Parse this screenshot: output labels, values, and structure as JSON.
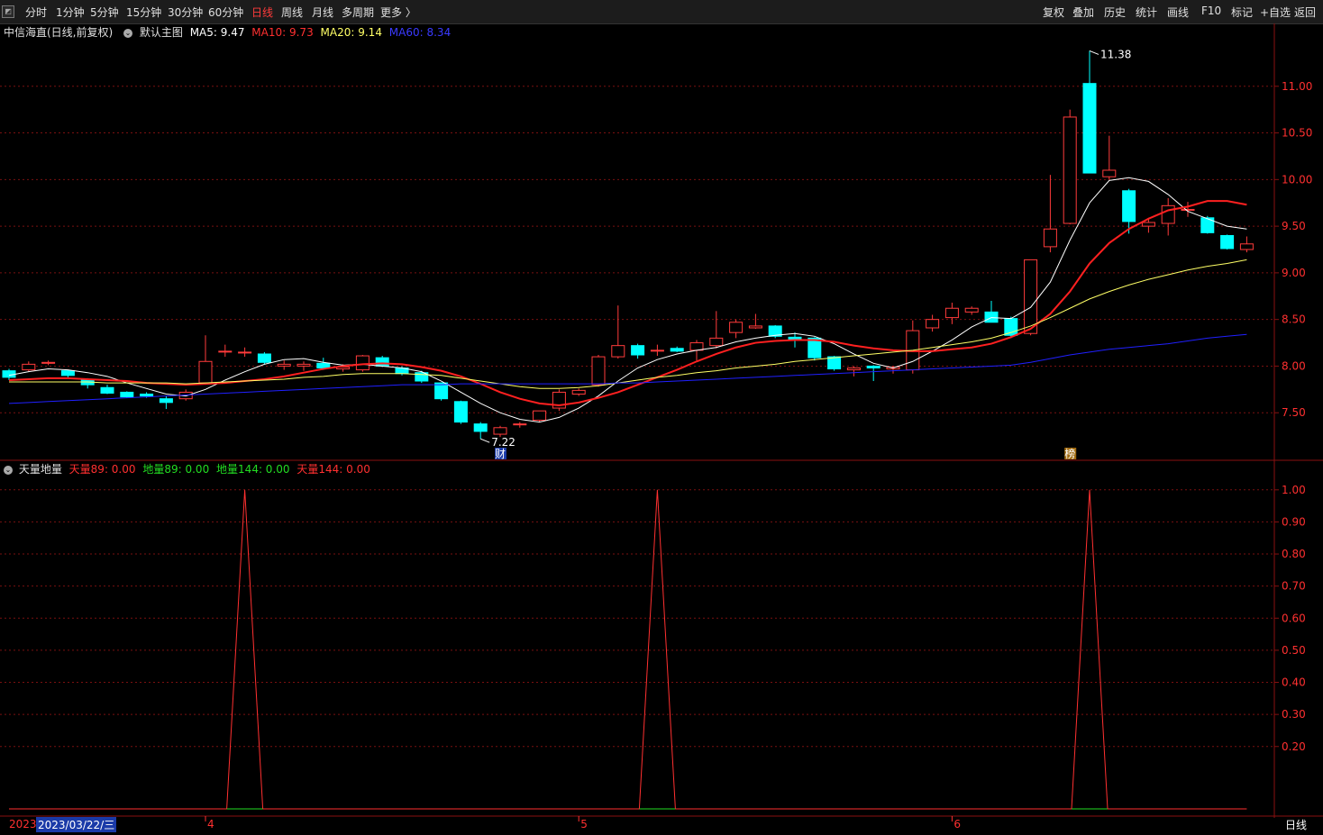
{
  "toolbar": {
    "periods": [
      "分时",
      "1分钟",
      "5分钟",
      "15分钟",
      "30分钟",
      "60分钟",
      "日线",
      "周线",
      "月线",
      "多周期",
      "更多 〉"
    ],
    "active_period": "日线",
    "right_buttons": [
      "复权",
      "叠加",
      "历史",
      "统计",
      "画线",
      "F10",
      "标记",
      "+自选",
      "返回"
    ]
  },
  "main_info": {
    "stock": "中信海直(日线,前复权)",
    "template": "默认主图",
    "ma5": "MA5: 9.47",
    "ma10": "MA10: 9.73",
    "ma20": "MA20: 9.14",
    "ma60": "MA60: 8.34"
  },
  "sub_info": {
    "name": "天量地量",
    "tian89": "天量89: 0.00",
    "di89": "地量89: 0.00",
    "di144": "地量144: 0.00",
    "tian144": "天量144: 0.00"
  },
  "annotations": {
    "high": "11.38",
    "low": "7.22",
    "marker_cai": "财",
    "marker_bang": "榜"
  },
  "x_axis": {
    "labels": [
      "2023",
      "4",
      "5",
      "6"
    ],
    "cursor_date": "2023/03/22/三",
    "period_label": "日线"
  },
  "colors": {
    "up": "#ff3b3b",
    "down": "#00ffff",
    "ma5": "#ffffff",
    "ma10": "#ff2020",
    "ma20": "#ffff66",
    "ma60": "#2020ff",
    "grid": "#7a1010"
  },
  "chart_data": [
    {
      "type": "candlestick",
      "title": "中信海直(日线,前复权)",
      "ylim": [
        7.0,
        11.5
      ],
      "yticks": [
        7.5,
        8.0,
        8.5,
        9.0,
        9.5,
        10.0,
        10.5,
        11.0
      ],
      "candles": [
        {
          "o": 7.95,
          "h": 7.97,
          "l": 7.85,
          "c": 7.88
        },
        {
          "o": 7.96,
          "h": 8.05,
          "l": 7.94,
          "c": 8.02
        },
        {
          "o": 8.03,
          "h": 8.06,
          "l": 8.01,
          "c": 8.04
        },
        {
          "o": 7.95,
          "h": 7.96,
          "l": 7.88,
          "c": 7.9
        },
        {
          "o": 7.85,
          "h": 7.87,
          "l": 7.76,
          "c": 7.8
        },
        {
          "o": 7.77,
          "h": 7.8,
          "l": 7.7,
          "c": 7.71
        },
        {
          "o": 7.72,
          "h": 7.73,
          "l": 7.66,
          "c": 7.67
        },
        {
          "o": 7.7,
          "h": 7.72,
          "l": 7.66,
          "c": 7.68
        },
        {
          "o": 7.65,
          "h": 7.68,
          "l": 7.54,
          "c": 7.61
        },
        {
          "o": 7.65,
          "h": 7.75,
          "l": 7.63,
          "c": 7.72
        },
        {
          "o": 7.82,
          "h": 8.33,
          "l": 7.8,
          "c": 8.05
        },
        {
          "o": 8.16,
          "h": 8.23,
          "l": 8.1,
          "c": 8.16
        },
        {
          "o": 8.15,
          "h": 8.2,
          "l": 8.1,
          "c": 8.15
        },
        {
          "o": 8.13,
          "h": 8.15,
          "l": 8.02,
          "c": 8.04
        },
        {
          "o": 8.0,
          "h": 8.06,
          "l": 7.96,
          "c": 8.02
        },
        {
          "o": 8.0,
          "h": 8.05,
          "l": 7.95,
          "c": 8.02
        },
        {
          "o": 8.03,
          "h": 8.09,
          "l": 7.96,
          "c": 7.98
        },
        {
          "o": 7.97,
          "h": 8.02,
          "l": 7.94,
          "c": 7.99
        },
        {
          "o": 7.96,
          "h": 8.12,
          "l": 7.94,
          "c": 8.11
        },
        {
          "o": 8.09,
          "h": 8.11,
          "l": 7.99,
          "c": 8.0
        },
        {
          "o": 7.98,
          "h": 8.0,
          "l": 7.9,
          "c": 7.92
        },
        {
          "o": 7.93,
          "h": 7.95,
          "l": 7.82,
          "c": 7.84
        },
        {
          "o": 7.82,
          "h": 7.82,
          "l": 7.63,
          "c": 7.65
        },
        {
          "o": 7.62,
          "h": 7.63,
          "l": 7.38,
          "c": 7.4
        },
        {
          "o": 7.38,
          "h": 7.4,
          "l": 7.22,
          "c": 7.3
        },
        {
          "o": 7.27,
          "h": 7.36,
          "l": 7.24,
          "c": 7.34
        },
        {
          "o": 7.37,
          "h": 7.4,
          "l": 7.34,
          "c": 7.38
        },
        {
          "o": 7.42,
          "h": 7.52,
          "l": 7.4,
          "c": 7.52
        },
        {
          "o": 7.55,
          "h": 7.75,
          "l": 7.52,
          "c": 7.72
        },
        {
          "o": 7.7,
          "h": 7.76,
          "l": 7.68,
          "c": 7.74
        },
        {
          "o": 7.8,
          "h": 8.12,
          "l": 7.78,
          "c": 8.1
        },
        {
          "o": 8.1,
          "h": 8.65,
          "l": 8.08,
          "c": 8.22
        },
        {
          "o": 8.22,
          "h": 8.24,
          "l": 8.08,
          "c": 8.12
        },
        {
          "o": 8.17,
          "h": 8.23,
          "l": 8.11,
          "c": 8.17
        },
        {
          "o": 8.19,
          "h": 8.21,
          "l": 8.15,
          "c": 8.16
        },
        {
          "o": 8.17,
          "h": 8.28,
          "l": 8.06,
          "c": 8.25
        },
        {
          "o": 8.22,
          "h": 8.59,
          "l": 8.19,
          "c": 8.3
        },
        {
          "o": 8.36,
          "h": 8.5,
          "l": 8.3,
          "c": 8.47
        },
        {
          "o": 8.41,
          "h": 8.56,
          "l": 8.4,
          "c": 8.43
        },
        {
          "o": 8.43,
          "h": 8.44,
          "l": 8.3,
          "c": 8.32
        },
        {
          "o": 8.31,
          "h": 8.36,
          "l": 8.2,
          "c": 8.28
        },
        {
          "o": 8.3,
          "h": 8.31,
          "l": 8.06,
          "c": 8.09
        },
        {
          "o": 8.1,
          "h": 8.11,
          "l": 7.95,
          "c": 7.97
        },
        {
          "o": 7.96,
          "h": 8.0,
          "l": 7.89,
          "c": 7.98
        },
        {
          "o": 8.0,
          "h": 8.01,
          "l": 7.84,
          "c": 7.98
        },
        {
          "o": 7.97,
          "h": 8.0,
          "l": 7.92,
          "c": 7.99
        },
        {
          "o": 7.96,
          "h": 8.49,
          "l": 7.92,
          "c": 8.38
        },
        {
          "o": 8.41,
          "h": 8.55,
          "l": 8.37,
          "c": 8.5
        },
        {
          "o": 8.52,
          "h": 8.68,
          "l": 8.45,
          "c": 8.62
        },
        {
          "o": 8.58,
          "h": 8.64,
          "l": 8.55,
          "c": 8.62
        },
        {
          "o": 8.58,
          "h": 8.7,
          "l": 8.55,
          "c": 8.47
        },
        {
          "o": 8.51,
          "h": 8.53,
          "l": 8.3,
          "c": 8.33
        },
        {
          "o": 8.35,
          "h": 9.14,
          "l": 8.33,
          "c": 9.14
        },
        {
          "o": 9.28,
          "h": 10.05,
          "l": 9.22,
          "c": 9.47
        },
        {
          "o": 9.53,
          "h": 10.75,
          "l": 9.52,
          "c": 10.67
        },
        {
          "o": 11.03,
          "h": 11.38,
          "l": 10.07,
          "c": 10.07
        },
        {
          "o": 10.03,
          "h": 10.47,
          "l": 10.0,
          "c": 10.1
        },
        {
          "o": 9.88,
          "h": 9.9,
          "l": 9.42,
          "c": 9.55
        },
        {
          "o": 9.5,
          "h": 9.59,
          "l": 9.43,
          "c": 9.54
        },
        {
          "o": 9.53,
          "h": 9.8,
          "l": 9.4,
          "c": 9.72
        },
        {
          "o": 9.68,
          "h": 9.76,
          "l": 9.6,
          "c": 9.68
        },
        {
          "o": 9.59,
          "h": 9.61,
          "l": 9.42,
          "c": 9.43
        },
        {
          "o": 9.4,
          "h": 9.41,
          "l": 9.25,
          "c": 9.26
        },
        {
          "o": 9.25,
          "h": 9.39,
          "l": 9.22,
          "c": 9.31
        }
      ],
      "series": [
        {
          "name": "MA5",
          "values": [
            7.9,
            7.94,
            7.97,
            7.96,
            7.93,
            7.89,
            7.82,
            7.76,
            7.7,
            7.68,
            7.75,
            7.85,
            7.94,
            8.02,
            8.07,
            8.08,
            8.04,
            8.01,
            8.02,
            8.0,
            7.98,
            7.94,
            7.84,
            7.72,
            7.6,
            7.5,
            7.43,
            7.4,
            7.45,
            7.55,
            7.68,
            7.84,
            7.98,
            8.07,
            8.13,
            8.17,
            8.2,
            8.26,
            8.3,
            8.33,
            8.35,
            8.32,
            8.24,
            8.13,
            8.03,
            7.98,
            8.05,
            8.16,
            8.28,
            8.42,
            8.52,
            8.51,
            8.63,
            8.9,
            9.35,
            9.75,
            9.99,
            10.02,
            9.98,
            9.84,
            9.66,
            9.58,
            9.5,
            9.47
          ]
        },
        {
          "name": "MA10",
          "values": [
            7.85,
            7.86,
            7.87,
            7.87,
            7.86,
            7.85,
            7.84,
            7.82,
            7.81,
            7.8,
            7.81,
            7.82,
            7.84,
            7.86,
            7.89,
            7.93,
            7.97,
            8.0,
            8.02,
            8.03,
            8.02,
            7.99,
            7.95,
            7.89,
            7.81,
            7.72,
            7.65,
            7.6,
            7.58,
            7.61,
            7.66,
            7.72,
            7.8,
            7.88,
            7.96,
            8.05,
            8.13,
            8.2,
            8.25,
            8.27,
            8.28,
            8.28,
            8.26,
            8.22,
            8.19,
            8.17,
            8.16,
            8.16,
            8.18,
            8.2,
            8.24,
            8.31,
            8.4,
            8.56,
            8.8,
            9.1,
            9.32,
            9.47,
            9.58,
            9.67,
            9.71,
            9.77,
            9.77,
            9.73
          ]
        },
        {
          "name": "MA20",
          "values": [
            7.83,
            7.83,
            7.83,
            7.83,
            7.83,
            7.82,
            7.82,
            7.82,
            7.82,
            7.81,
            7.82,
            7.83,
            7.84,
            7.85,
            7.86,
            7.88,
            7.89,
            7.91,
            7.92,
            7.92,
            7.92,
            7.91,
            7.9,
            7.87,
            7.84,
            7.81,
            7.78,
            7.76,
            7.76,
            7.77,
            7.79,
            7.82,
            7.85,
            7.88,
            7.9,
            7.93,
            7.95,
            7.98,
            8.0,
            8.02,
            8.05,
            8.07,
            8.09,
            8.11,
            8.13,
            8.15,
            8.17,
            8.2,
            8.23,
            8.26,
            8.3,
            8.36,
            8.43,
            8.52,
            8.62,
            8.72,
            8.8,
            8.87,
            8.93,
            8.98,
            9.03,
            9.07,
            9.1,
            9.14
          ]
        },
        {
          "name": "MA60",
          "values": [
            7.6,
            7.61,
            7.62,
            7.63,
            7.64,
            7.65,
            7.66,
            7.67,
            7.68,
            7.69,
            7.7,
            7.71,
            7.72,
            7.73,
            7.74,
            7.75,
            7.76,
            7.77,
            7.78,
            7.79,
            7.8,
            7.8,
            7.8,
            7.81,
            7.81,
            7.81,
            7.81,
            7.81,
            7.81,
            7.81,
            7.81,
            7.82,
            7.82,
            7.83,
            7.84,
            7.85,
            7.86,
            7.87,
            7.88,
            7.89,
            7.9,
            7.91,
            7.92,
            7.93,
            7.94,
            7.95,
            7.96,
            7.97,
            7.98,
            7.99,
            8.0,
            8.01,
            8.04,
            8.08,
            8.12,
            8.15,
            8.18,
            8.2,
            8.22,
            8.24,
            8.27,
            8.3,
            8.32,
            8.34
          ]
        }
      ]
    },
    {
      "type": "line",
      "title": "天量地量",
      "ylim": [
        0,
        1.05
      ],
      "yticks": [
        0.2,
        0.3,
        0.4,
        0.5,
        0.6,
        0.7,
        0.8,
        0.9,
        1.0
      ],
      "series": [
        {
          "name": "天量89",
          "values": [
            0,
            0,
            0,
            0,
            0,
            0,
            0,
            0,
            0,
            0,
            0,
            0,
            1,
            0,
            0,
            0,
            0,
            0,
            0,
            0,
            0,
            0,
            0,
            0,
            0,
            0,
            0,
            0,
            0,
            0,
            0,
            0,
            0,
            1,
            0,
            0,
            0,
            0,
            0,
            0,
            0,
            0,
            0,
            0,
            0,
            0,
            0,
            0,
            0,
            0,
            0,
            0,
            0,
            0,
            0,
            1,
            0,
            0,
            0,
            0,
            0,
            0,
            0,
            0
          ]
        },
        {
          "name": "地量89",
          "values": [
            0,
            0,
            0,
            0,
            0,
            0,
            0,
            0,
            0,
            0,
            0,
            0,
            0,
            0,
            0,
            0,
            0,
            0,
            0,
            0,
            0,
            0,
            0,
            0,
            0,
            0,
            0,
            0,
            0,
            0,
            0,
            0,
            0,
            0,
            0,
            0,
            0,
            0,
            0,
            0,
            0,
            0,
            0,
            0,
            0,
            0,
            0,
            0,
            0,
            0,
            0,
            0,
            0,
            0,
            0,
            0,
            0,
            0,
            0,
            0,
            0,
            0,
            0,
            0
          ]
        }
      ]
    }
  ]
}
